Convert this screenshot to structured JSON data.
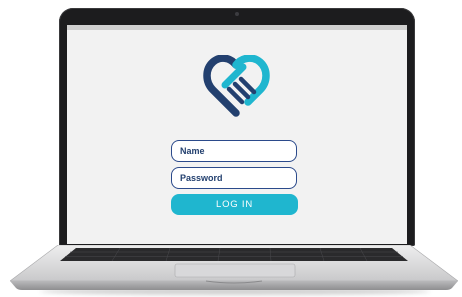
{
  "login": {
    "name_placeholder": "Name",
    "password_placeholder": "Password",
    "login_button": "LOG IN"
  },
  "brand": {
    "logo_icon": "heart-hand-logo-icon",
    "colors": {
      "navy": "#23406f",
      "teal": "#1fb6cf",
      "background": "#f2f2f2"
    }
  }
}
